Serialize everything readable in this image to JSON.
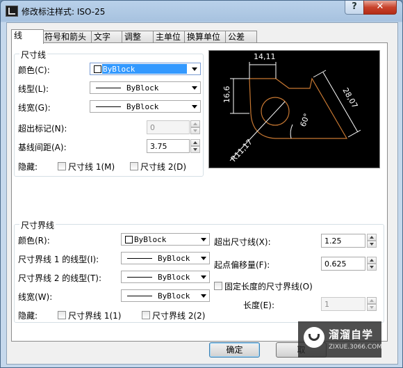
{
  "window": {
    "title": "修改标注样式: ISO-25",
    "help_label": "?",
    "close_label": "✕"
  },
  "tabs": [
    "线",
    "符号和箭头",
    "文字",
    "调整",
    "主单位",
    "换算单位",
    "公差"
  ],
  "dim_lines": {
    "group_title": "尺寸线",
    "color_label": "颜色(C):",
    "color_value": "ByBlock",
    "linetype_label": "线型(L):",
    "linetype_value": "ByBlock",
    "lineweight_label": "线宽(G):",
    "lineweight_value": "ByBlock",
    "extend_label": "超出标记(N):",
    "extend_value": "0",
    "baseline_label": "基线间距(A):",
    "baseline_value": "3.75",
    "suppress_label": "隐藏:",
    "suppress_1": "尺寸线 1(M)",
    "suppress_2": "尺寸线 2(D)"
  },
  "ext_lines": {
    "group_title": "尺寸界线",
    "color_label": "颜色(R):",
    "color_value": "ByBlock",
    "lt1_label": "尺寸界线 1 的线型(I):",
    "lt1_value": "ByBlock",
    "lt2_label": "尺寸界线 2 的线型(T):",
    "lt2_value": "ByBlock",
    "lineweight_label": "线宽(W):",
    "lineweight_value": "ByBlock",
    "suppress_label": "隐藏:",
    "suppress_1": "尺寸界线 1(1)",
    "suppress_2": "尺寸界线 2(2)",
    "extend_label": "超出尺寸线(X):",
    "extend_value": "1.25",
    "offset_label": "起点偏移量(F):",
    "offset_value": "0.625",
    "fixed_label": "固定长度的尺寸界线(O)",
    "length_label": "长度(E):",
    "length_value": "1"
  },
  "preview": {
    "dim_top": "14,11",
    "dim_left": "16,6",
    "dim_slant": "28,07",
    "dim_angle": "60°",
    "dim_radius": "R11,17"
  },
  "buttons": {
    "ok": "确定",
    "cancel": "取"
  },
  "watermark": {
    "name": "溜溜自学",
    "url": "ZIXUE.3066.COM"
  },
  "colors": {
    "selection": "#3399ff",
    "preview_bg": "#000000",
    "shape_line": "#c87832",
    "dim_line": "#ffffff"
  }
}
